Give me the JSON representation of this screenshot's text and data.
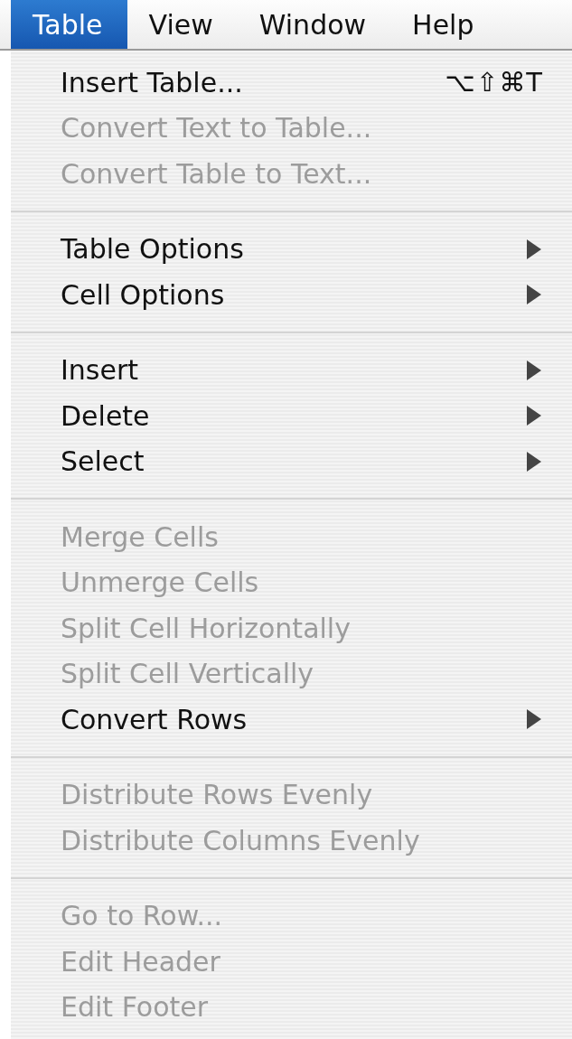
{
  "menu_bar": [
    {
      "label": "Table",
      "selected": true
    },
    {
      "label": "View",
      "selected": false
    },
    {
      "label": "Window",
      "selected": false
    },
    {
      "label": "Help",
      "selected": false
    }
  ],
  "menu": {
    "groups": [
      [
        {
          "label": "Insert Table...",
          "disabled": false,
          "submenu": false,
          "shortcut": "⌥⇧⌘T"
        },
        {
          "label": "Convert Text to Table...",
          "disabled": true,
          "submenu": false
        },
        {
          "label": "Convert Table to Text...",
          "disabled": true,
          "submenu": false
        }
      ],
      [
        {
          "label": "Table Options",
          "disabled": false,
          "submenu": true
        },
        {
          "label": "Cell Options",
          "disabled": false,
          "submenu": true
        }
      ],
      [
        {
          "label": "Insert",
          "disabled": false,
          "submenu": true
        },
        {
          "label": "Delete",
          "disabled": false,
          "submenu": true
        },
        {
          "label": "Select",
          "disabled": false,
          "submenu": true
        }
      ],
      [
        {
          "label": "Merge Cells",
          "disabled": true,
          "submenu": false
        },
        {
          "label": "Unmerge Cells",
          "disabled": true,
          "submenu": false
        },
        {
          "label": "Split Cell Horizontally",
          "disabled": true,
          "submenu": false
        },
        {
          "label": "Split Cell Vertically",
          "disabled": true,
          "submenu": false
        },
        {
          "label": "Convert Rows",
          "disabled": false,
          "submenu": true
        }
      ],
      [
        {
          "label": "Distribute Rows Evenly",
          "disabled": true,
          "submenu": false
        },
        {
          "label": "Distribute Columns Evenly",
          "disabled": true,
          "submenu": false
        }
      ],
      [
        {
          "label": "Go to Row...",
          "disabled": true,
          "submenu": false
        },
        {
          "label": "Edit Header",
          "disabled": true,
          "submenu": false
        },
        {
          "label": "Edit Footer",
          "disabled": true,
          "submenu": false
        }
      ]
    ]
  }
}
